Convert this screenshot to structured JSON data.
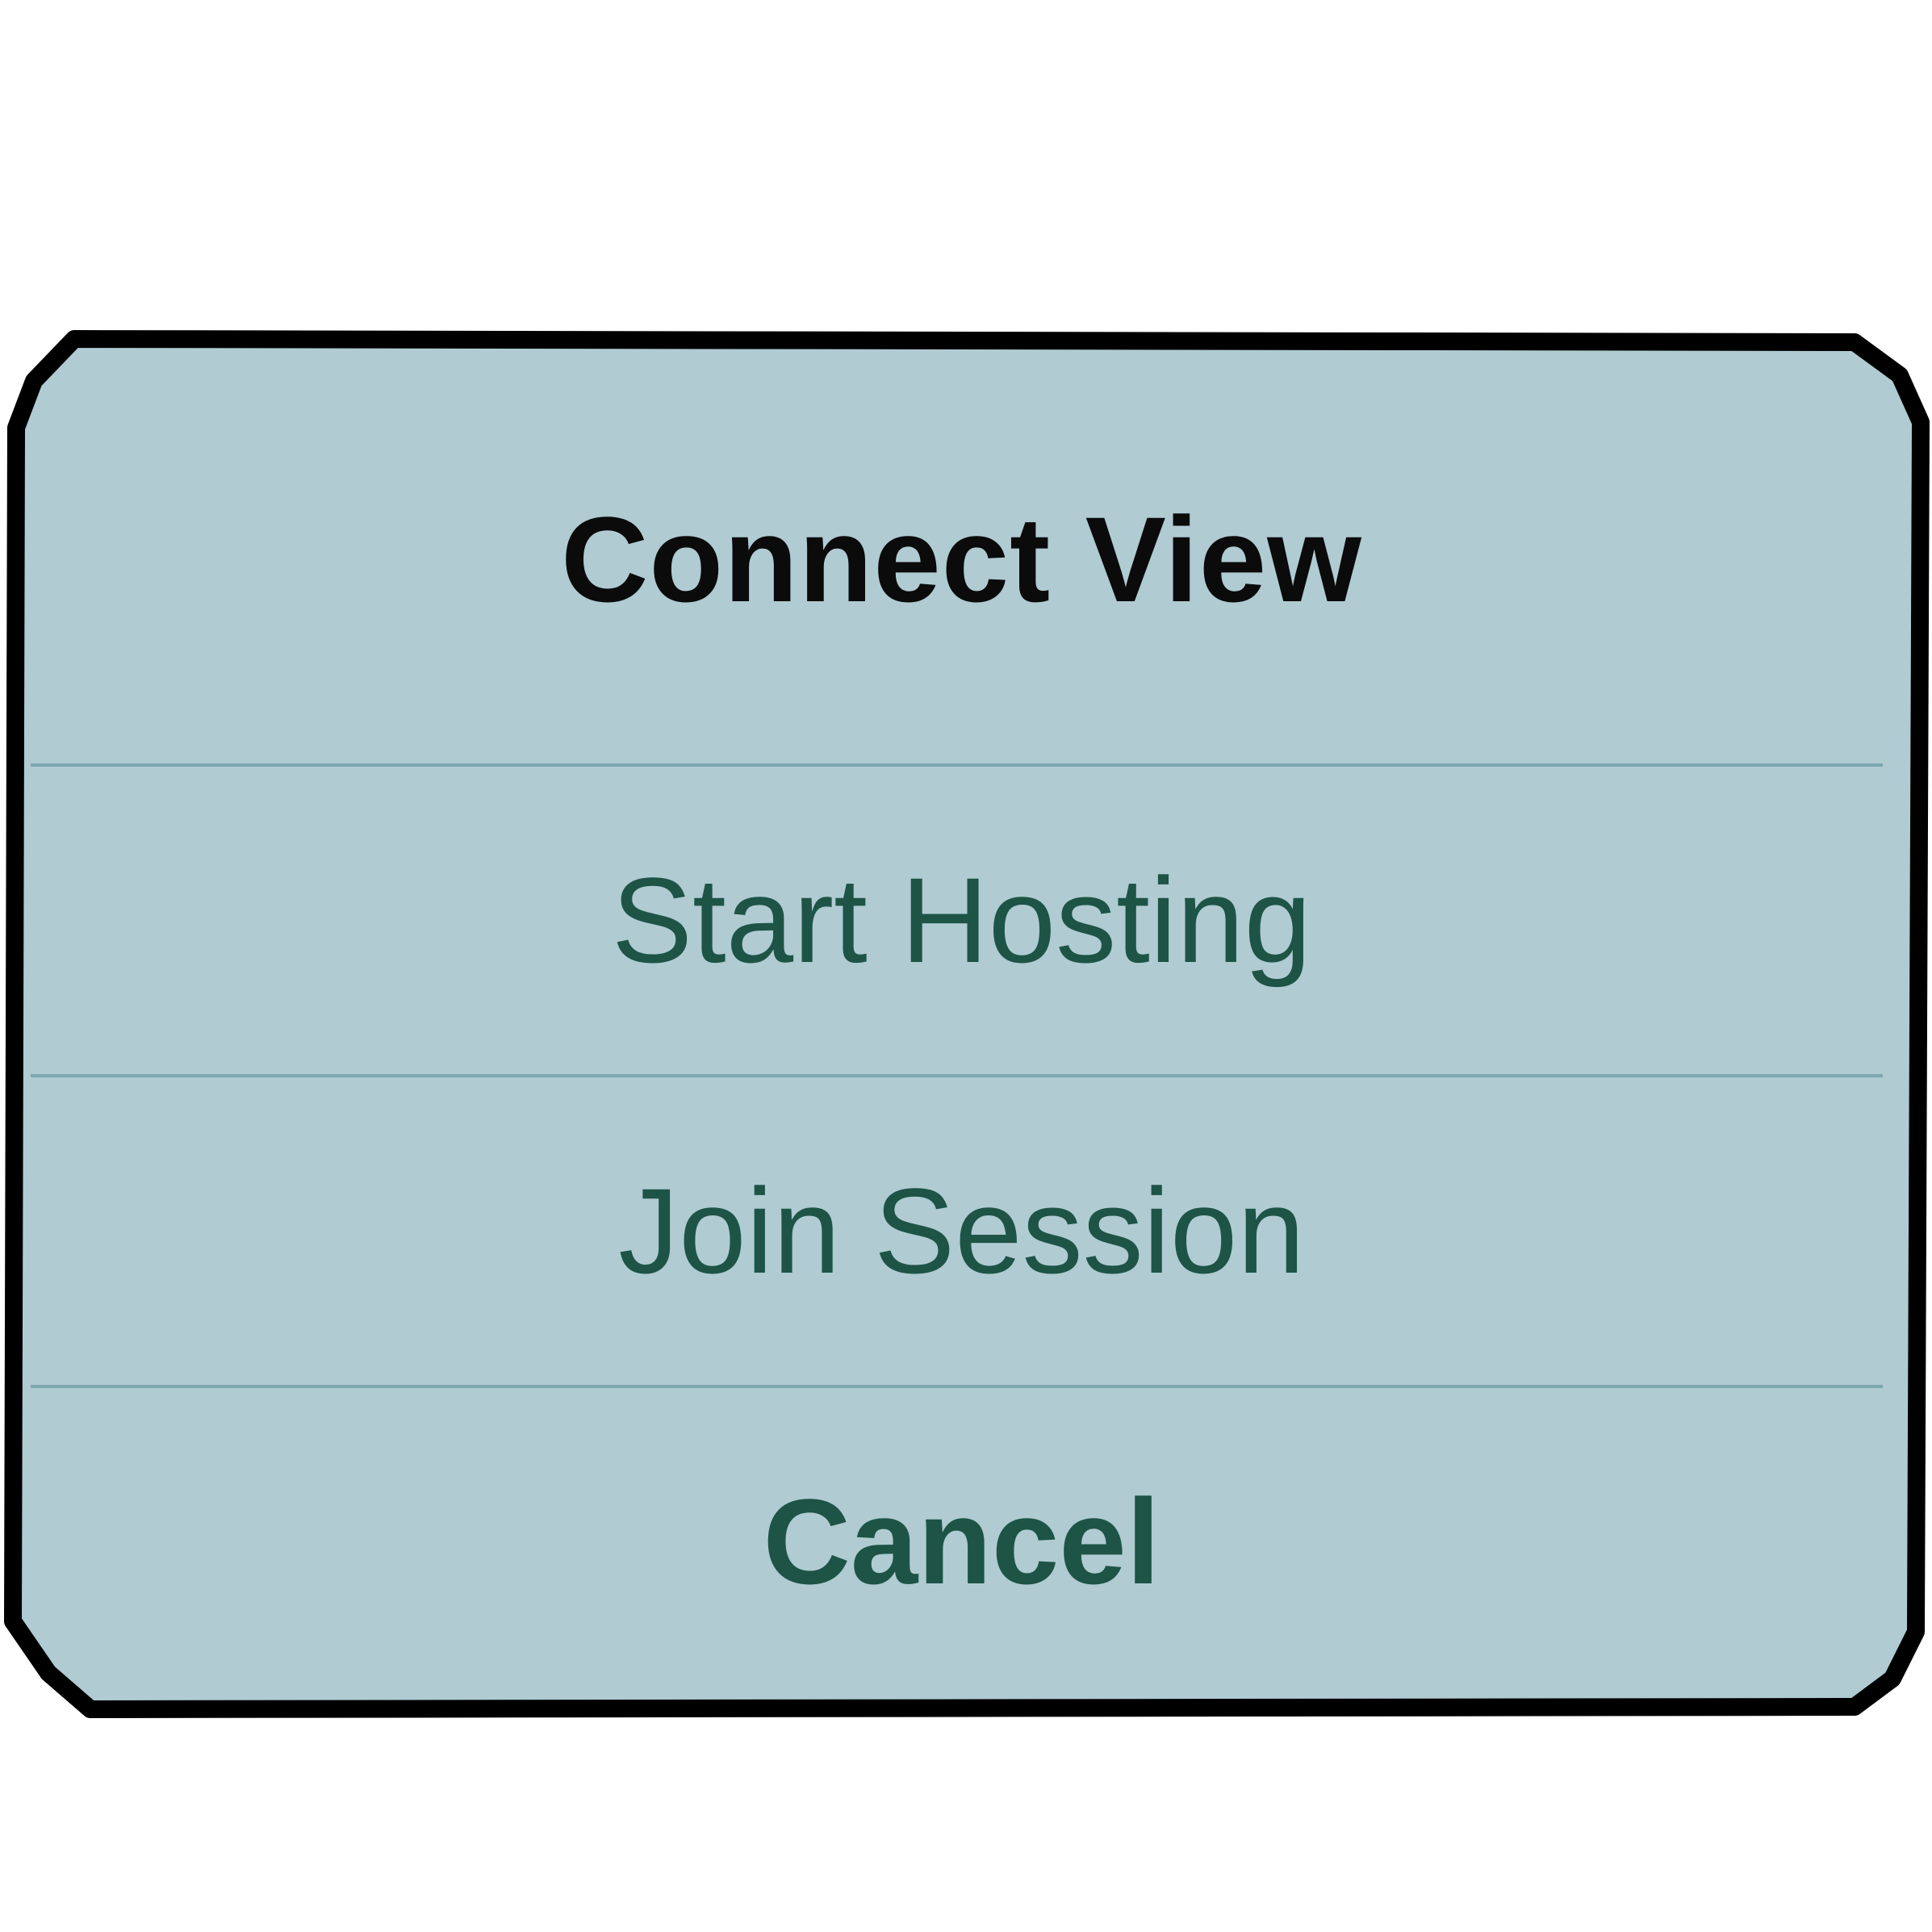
{
  "dialog": {
    "title": "Connect View",
    "actions": [
      {
        "label": "Start Hosting"
      },
      {
        "label": "Join Session"
      }
    ],
    "cancel_label": "Cancel"
  },
  "colors": {
    "background": "#ffffff",
    "sheet_fill": "#b0cbd2",
    "border": "#000000",
    "divider": "#7ea7b0",
    "title_text": "#0b0b0b",
    "action_text": "#1d5446"
  }
}
